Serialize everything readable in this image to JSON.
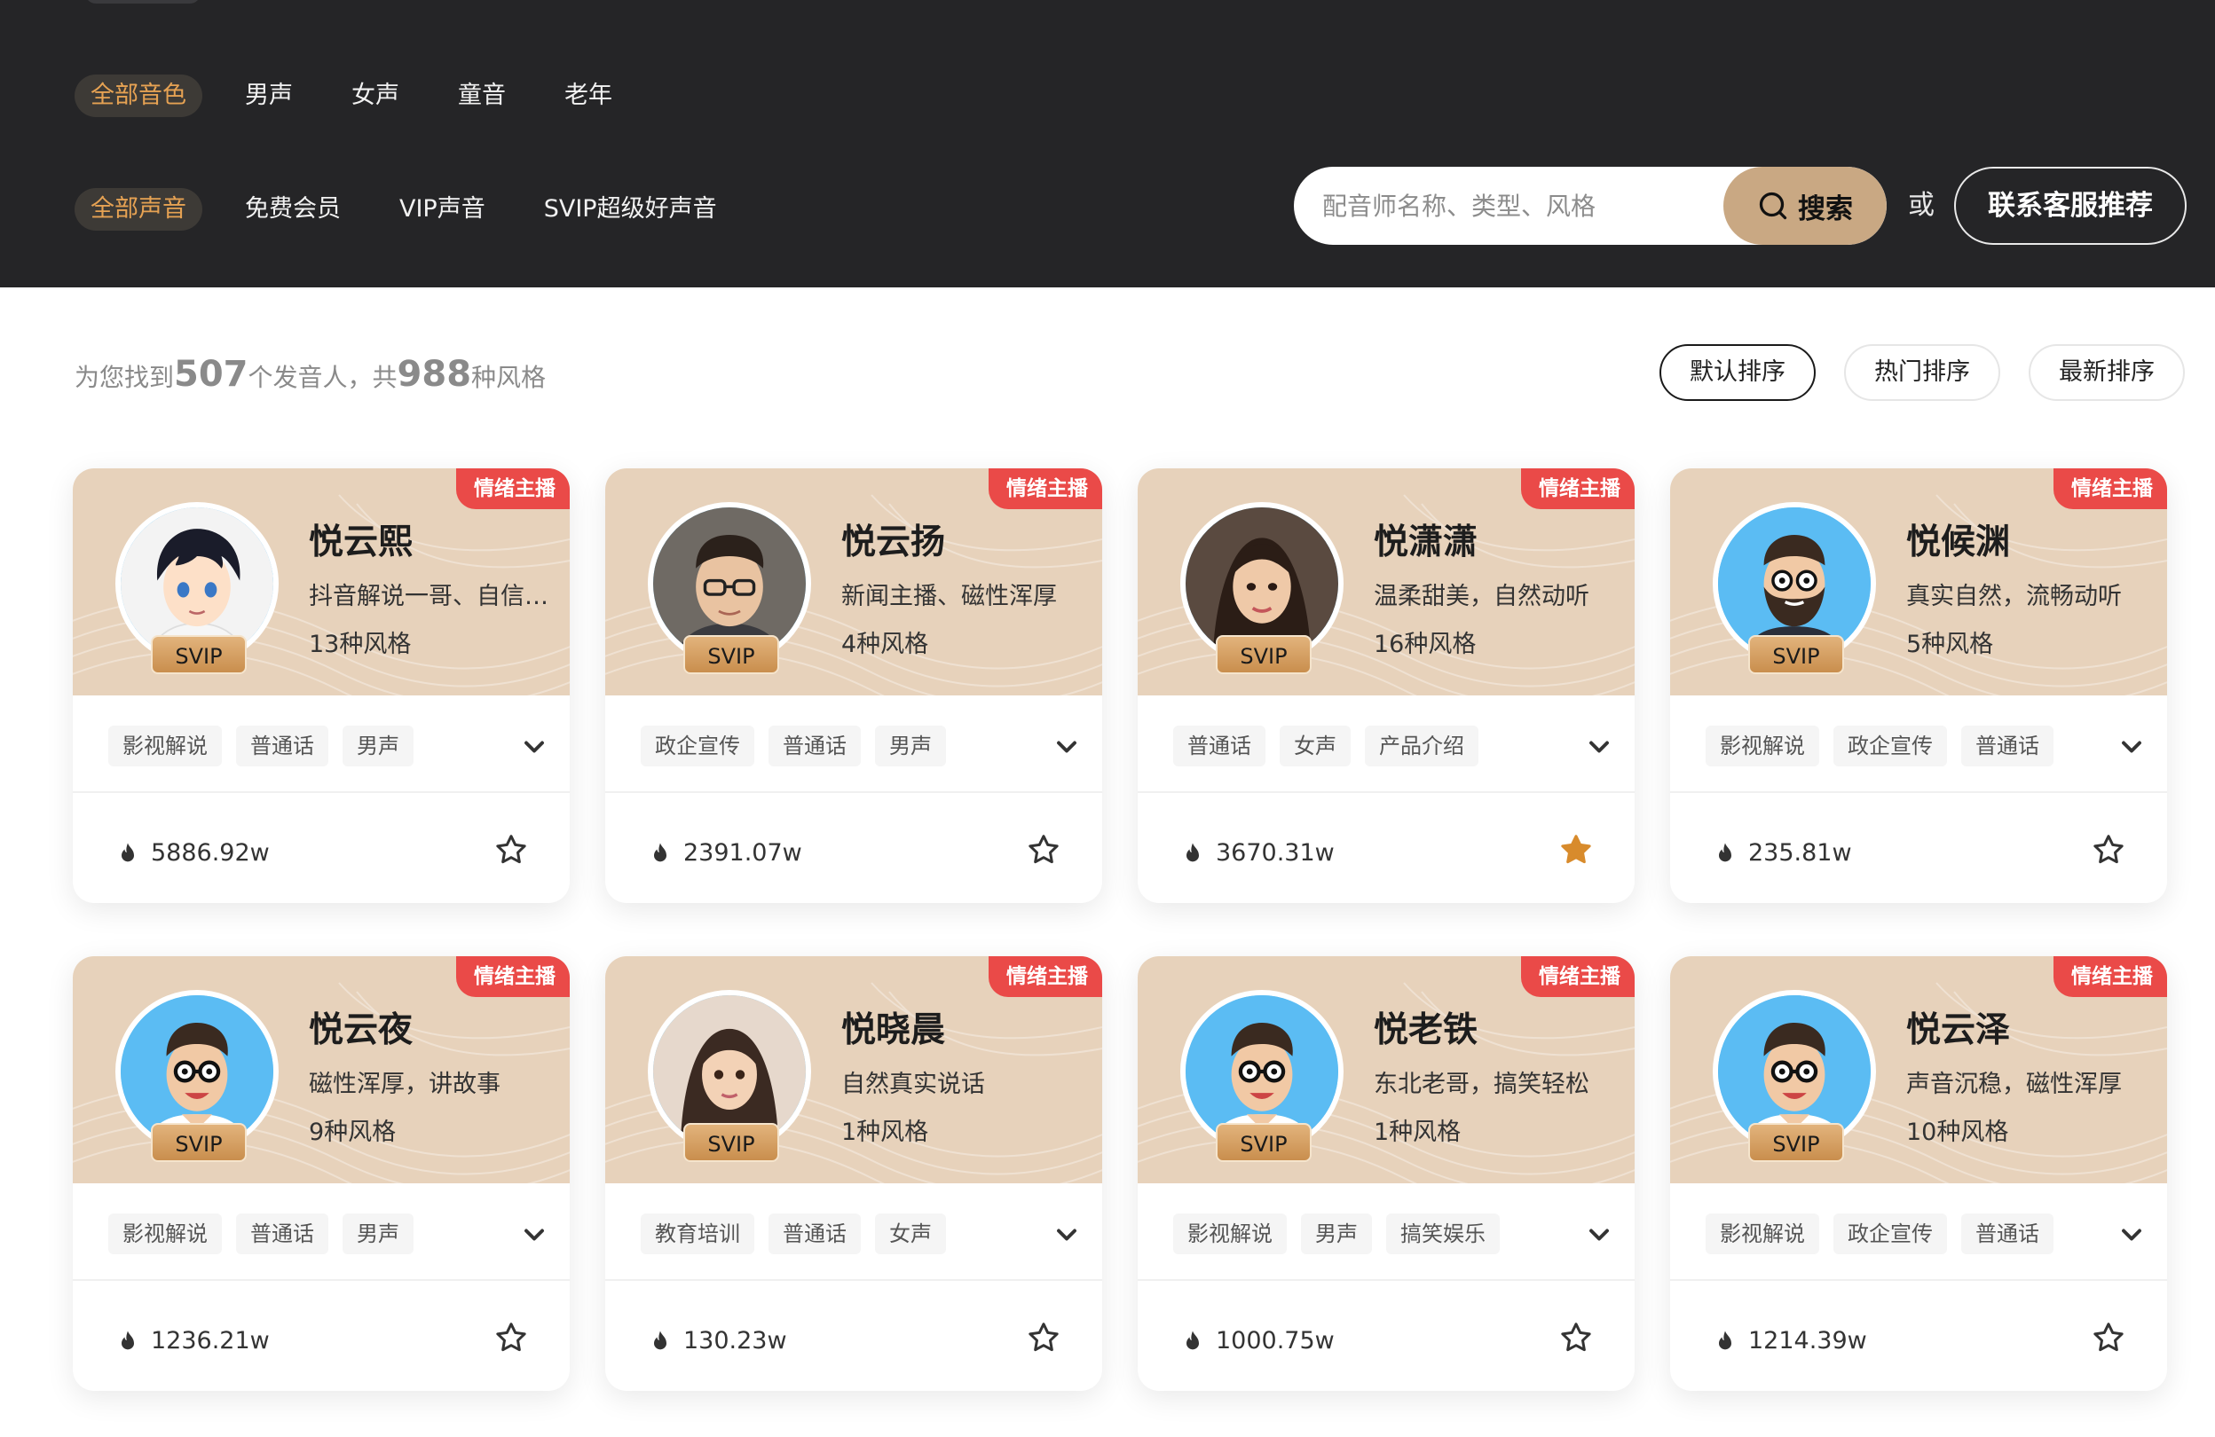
{
  "filters": {
    "timbre": [
      {
        "label": "全部音色",
        "active": true
      },
      {
        "label": "男声",
        "active": false
      },
      {
        "label": "女声",
        "active": false
      },
      {
        "label": "童音",
        "active": false
      },
      {
        "label": "老年",
        "active": false
      }
    ],
    "tier": [
      {
        "label": "全部声音",
        "active": true
      },
      {
        "label": "免费会员",
        "active": false
      },
      {
        "label": "VIP声音",
        "active": false
      },
      {
        "label": "SVIP超级好声音",
        "active": false
      }
    ]
  },
  "search": {
    "placeholder": "配音师名称、类型、风格",
    "button_label": "搜索",
    "or_label": "或",
    "contact_label": "联系客服推荐"
  },
  "results": {
    "prefix": "为您找到",
    "speaker_count": "507",
    "middle": "个发音人，共",
    "style_count": "988",
    "suffix": "种风格"
  },
  "sort": [
    {
      "label": "默认排序",
      "active": true
    },
    {
      "label": "热门排序",
      "active": false
    },
    {
      "label": "最新排序",
      "active": false
    }
  ],
  "colors": {
    "header_bg": "#252527",
    "accent_orange": "#e6a253",
    "card_top": "#e7d2bb",
    "badge_red": "#ea4a48",
    "search_btn": "#c9a883",
    "fav_active": "#d88b2c"
  },
  "cards": [
    {
      "badge": "情绪主播",
      "name": "悦云熙",
      "desc": "抖音解说一哥、自信阳光",
      "styles": "13种风格",
      "tier": "SVIP",
      "tags": [
        "影视解说",
        "普通话",
        "男声"
      ],
      "plays": "5886.92w",
      "favorited": false,
      "avatar": "anime-boy-avatar"
    },
    {
      "badge": "情绪主播",
      "name": "悦云扬",
      "desc": "新闻主播、磁性浑厚",
      "styles": "4种风格",
      "tier": "SVIP",
      "tags": [
        "政企宣传",
        "普通话",
        "男声"
      ],
      "plays": "2391.07w",
      "favorited": false,
      "avatar": "glasses-man-avatar"
    },
    {
      "badge": "情绪主播",
      "name": "悦潇潇",
      "desc": "温柔甜美，自然动听",
      "styles": "16种风格",
      "tier": "SVIP",
      "tags": [
        "普通话",
        "女声",
        "产品介绍"
      ],
      "plays": "3670.31w",
      "favorited": true,
      "avatar": "woman-avatar"
    },
    {
      "badge": "情绪主播",
      "name": "悦候渊",
      "desc": "真实自然，流畅动听",
      "styles": "5种风格",
      "tier": "SVIP",
      "tags": [
        "影视解说",
        "政企宣传",
        "普通话"
      ],
      "plays": "235.81w",
      "favorited": false,
      "avatar": "bearded-man-avatar"
    },
    {
      "badge": "情绪主播",
      "name": "悦云夜",
      "desc": "磁性浑厚，讲故事",
      "styles": "9种风格",
      "tier": "SVIP",
      "tags": [
        "影视解说",
        "普通话",
        "男声"
      ],
      "plays": "1236.21w",
      "favorited": false,
      "avatar": "cartoon-man-avatar"
    },
    {
      "badge": "情绪主播",
      "name": "悦晓晨",
      "desc": "自然真实说话",
      "styles": "1种风格",
      "tier": "SVIP",
      "tags": [
        "教育培训",
        "普通话",
        "女声"
      ],
      "plays": "130.23w",
      "favorited": false,
      "avatar": "girl-avatar"
    },
    {
      "badge": "情绪主播",
      "name": "悦老铁",
      "desc": "东北老哥，搞笑轻松",
      "styles": "1种风格",
      "tier": "SVIP",
      "tags": [
        "影视解说",
        "男声",
        "搞笑娱乐"
      ],
      "plays": "1000.75w",
      "favorited": false,
      "avatar": "cartoon-man-avatar"
    },
    {
      "badge": "情绪主播",
      "name": "悦云泽",
      "desc": "声音沉稳，磁性浑厚",
      "styles": "10种风格",
      "tier": "SVIP",
      "tags": [
        "影视解说",
        "政企宣传",
        "普通话"
      ],
      "plays": "1214.39w",
      "favorited": false,
      "avatar": "cartoon-man-avatar"
    }
  ]
}
